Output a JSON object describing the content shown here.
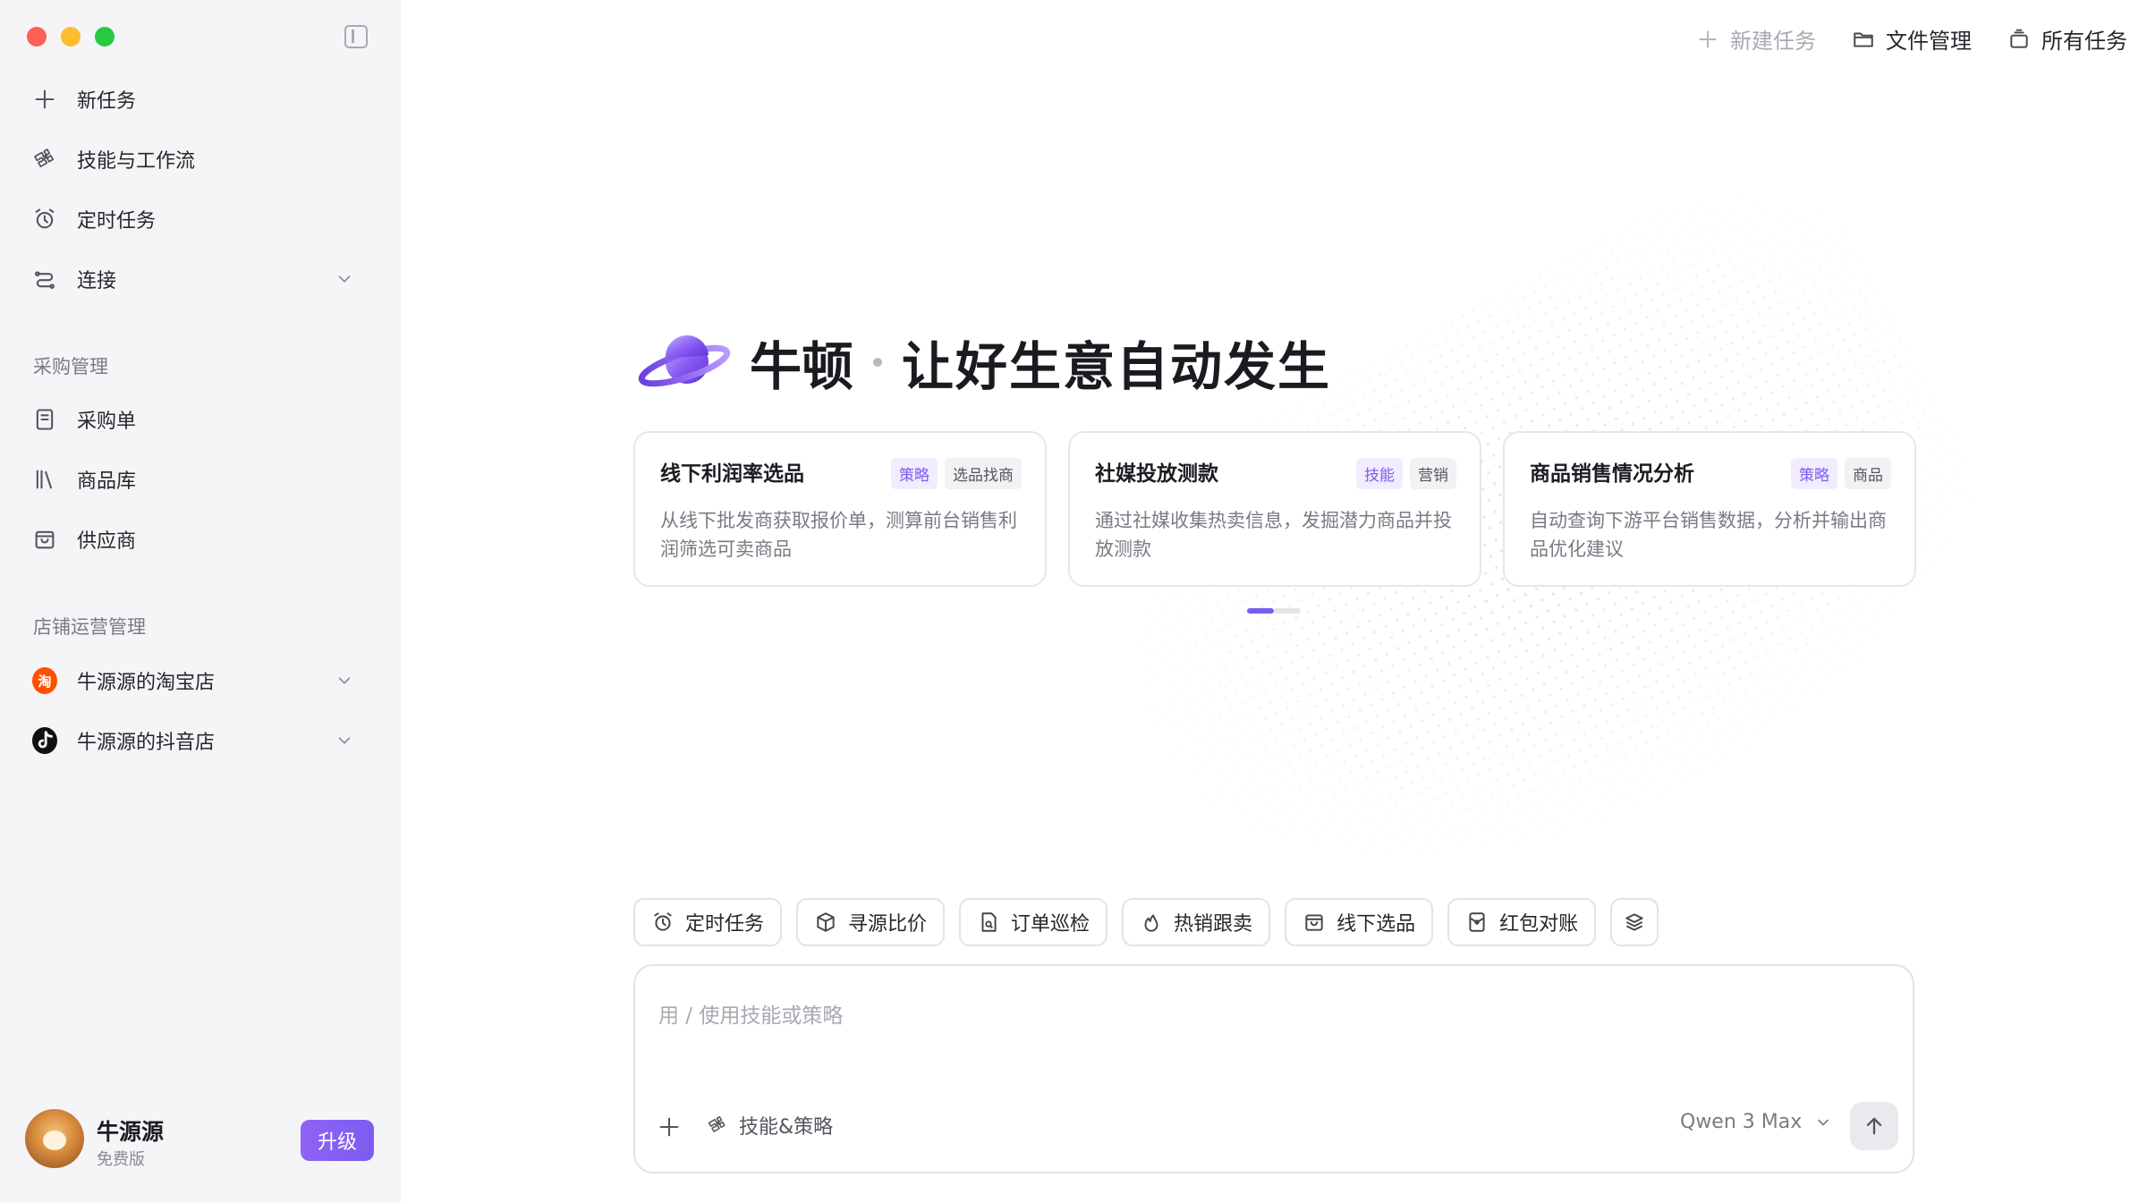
{
  "sidebar": {
    "main_nav": [
      {
        "label": "新任务",
        "icon": "plus-icon"
      },
      {
        "label": "技能与工作流",
        "icon": "puzzle-icon"
      },
      {
        "label": "定时任务",
        "icon": "alarm-clock-icon"
      },
      {
        "label": "连接",
        "icon": "connection-icon"
      }
    ],
    "sections": [
      {
        "title": "采购管理",
        "items": [
          {
            "label": "采购单",
            "icon": "document-icon"
          },
          {
            "label": "商品库",
            "icon": "library-icon"
          },
          {
            "label": "供应商",
            "icon": "store-bag-icon"
          }
        ]
      },
      {
        "title": "店铺运营管理",
        "items": [
          {
            "label": "牛源源的淘宝店",
            "icon": "taobao-icon",
            "icon_text": "淘",
            "color": "#ff5000"
          },
          {
            "label": "牛源源的抖音店",
            "icon": "douyin-icon",
            "color": "#111111"
          }
        ]
      }
    ],
    "user": {
      "name": "牛源源",
      "plan": "免费版",
      "upgrade_label": "升级"
    }
  },
  "topbar": {
    "new_task": "新建任务",
    "file_manager": "文件管理",
    "all_tasks": "所有任务"
  },
  "hero": {
    "brand": "牛顿",
    "slogan": "让好生意自动发生"
  },
  "cards": [
    {
      "title": "线下利润率选品",
      "tags": [
        {
          "text": "策略",
          "accent": true
        },
        {
          "text": "选品找商",
          "accent": false
        }
      ],
      "desc": "从线下批发商获取报价单，测算前台销售利润筛选可卖商品"
    },
    {
      "title": "社媒投放测款",
      "tags": [
        {
          "text": "技能",
          "accent": true
        },
        {
          "text": "营销",
          "accent": false
        }
      ],
      "desc": "通过社媒收集热卖信息，发掘潜力商品并投放测款"
    },
    {
      "title": "商品销售情况分析",
      "tags": [
        {
          "text": "策略",
          "accent": true
        },
        {
          "text": "商品",
          "accent": false
        }
      ],
      "desc": "自动查询下游平台销售数据，分析并输出商品优化建议"
    }
  ],
  "carousel": {
    "active_page": 1,
    "total_pages": 2
  },
  "quick_chips": [
    {
      "label": "定时任务",
      "icon": "alarm-clock-icon"
    },
    {
      "label": "寻源比价",
      "icon": "box-icon"
    },
    {
      "label": "订单巡检",
      "icon": "file-search-icon"
    },
    {
      "label": "热销跟卖",
      "icon": "flame-icon"
    },
    {
      "label": "线下选品",
      "icon": "store-bag-icon"
    },
    {
      "label": "红包对账",
      "icon": "red-packet-icon"
    }
  ],
  "composer": {
    "placeholder": "用 / 使用技能或策略",
    "skills_label": "技能&策略",
    "model": "Qwen 3 Max"
  },
  "colors": {
    "accent": "#7b5cf0",
    "sidebar_bg": "#f5f5f7"
  }
}
